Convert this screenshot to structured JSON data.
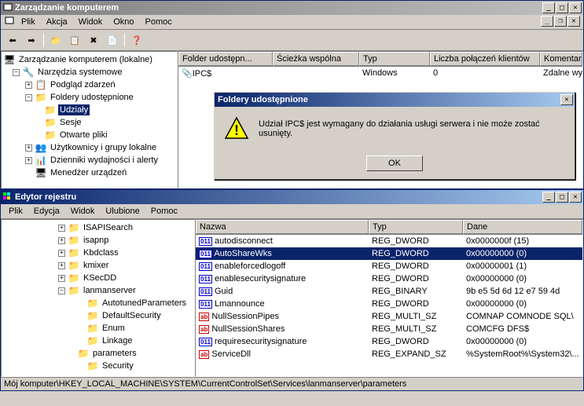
{
  "mgmt": {
    "title": "Zarządzanie komputerem",
    "menus": [
      "Plik",
      "Akcja",
      "Widok",
      "Okno",
      "Pomoc"
    ],
    "tree": {
      "root": "Zarządzanie komputerem (lokalne)",
      "tools": "Narzędzia systemowe",
      "events": "Podgląd zdarzeń",
      "shared": "Foldery udostępnione",
      "shares": "Udziały",
      "sessions": "Sesje",
      "openfiles": "Otwarte pliki",
      "users": "Użytkownicy i grupy lokalne",
      "perf": "Dzienniki wydajności i alerty",
      "devmgr": "Menedżer urządzeń"
    },
    "columns": {
      "folder": "Folder udostępn...",
      "path": "Ścieżka wspólna",
      "type": "Typ",
      "conn": "Liczba połączeń klientów",
      "comment": "Komentarz"
    },
    "rows": [
      {
        "name": "IPC$",
        "path": "",
        "type": "Windows",
        "conn": "0",
        "comment": "Zdalne wy"
      }
    ]
  },
  "dialog": {
    "title": "Foldery udostępnione",
    "msg": "Udział IPC$ jest wymagany do działania usługi serwera i nie może zostać usunięty.",
    "ok": "OK"
  },
  "reg": {
    "title": "Edytor rejestru",
    "menus": [
      "Plik",
      "Edycja",
      "Widok",
      "Ulubione",
      "Pomoc"
    ],
    "tree": [
      "ISAPISearch",
      "isapnp",
      "Kbdclass",
      "kmixer",
      "KSecDD",
      "lanmanserver"
    ],
    "lantree": [
      "AutotunedParameters",
      "DefaultSecurity",
      "Enum",
      "Linkage",
      "parameters",
      "Security"
    ],
    "columns": {
      "name": "Nazwa",
      "type": "Typ",
      "data": "Dane"
    },
    "values": [
      {
        "icon": "num",
        "name": "autodisconnect",
        "type": "REG_DWORD",
        "data": "0x0000000f (15)"
      },
      {
        "icon": "num",
        "name": "AutoShareWks",
        "type": "REG_DWORD",
        "data": "0x00000000 (0)",
        "selected": true
      },
      {
        "icon": "num",
        "name": "enableforcedlogoff",
        "type": "REG_DWORD",
        "data": "0x00000001 (1)"
      },
      {
        "icon": "num",
        "name": "enablesecuritysignature",
        "type": "REG_DWORD",
        "data": "0x00000000 (0)"
      },
      {
        "icon": "num",
        "name": "Guid",
        "type": "REG_BINARY",
        "data": "9b e5 5d 6d 12 e7 59 4d"
      },
      {
        "icon": "num",
        "name": "Lmannounce",
        "type": "REG_DWORD",
        "data": "0x00000000 (0)"
      },
      {
        "icon": "str",
        "name": "NullSessionPipes",
        "type": "REG_MULTI_SZ",
        "data": "COMNAP COMNODE SQL\\"
      },
      {
        "icon": "str",
        "name": "NullSessionShares",
        "type": "REG_MULTI_SZ",
        "data": "COMCFG DFS$"
      },
      {
        "icon": "num",
        "name": "requiresecuritysignature",
        "type": "REG_DWORD",
        "data": "0x00000000 (0)"
      },
      {
        "icon": "str",
        "name": "ServiceDll",
        "type": "REG_EXPAND_SZ",
        "data": "%SystemRoot%\\System32\\..."
      }
    ],
    "status": "Mój komputer\\HKEY_LOCAL_MACHINE\\SYSTEM\\CurrentControlSet\\Services\\lanmanserver\\parameters"
  }
}
